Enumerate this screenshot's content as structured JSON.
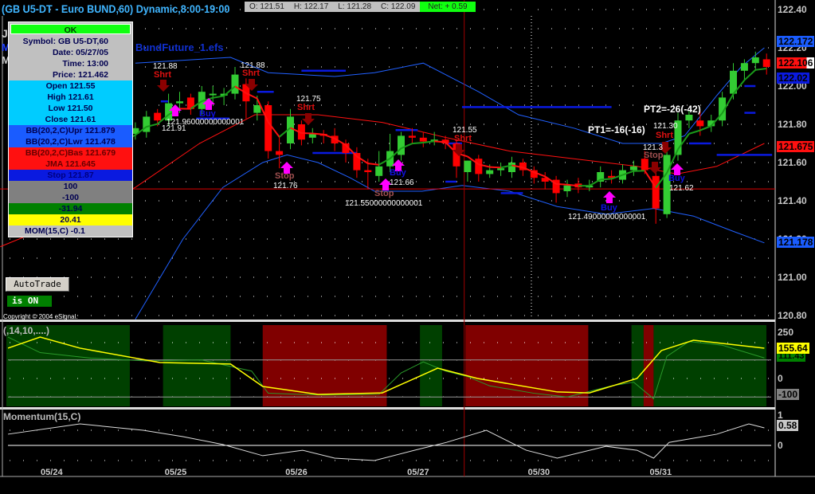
{
  "header": {
    "title": "(GB U5-DT - Euro BUND,60) Dynamic,8:00-19:00",
    "open": "O: 121.51",
    "high": "H: 122.17",
    "low": "L: 121.28",
    "close": "C: 122.09",
    "net": "Net: + 0.59"
  },
  "left_letters": [
    "J",
    "M",
    "M"
  ],
  "study_label": "BundFuture_1.efs",
  "popup": {
    "ok": "OK",
    "symbol": "Symbol: GB U5-DT,60",
    "date": "Date: 05/27/05",
    "time": "Time: 13:00",
    "price": "Price: 121.462",
    "open": "Open 121.55",
    "high": "High 121.61",
    "low": "Low 121.50",
    "close": "Close 121.61",
    "bbu": "BB(20,2,C)Upr 121.879",
    "bbl": "BB(20,2,C)Lwr 121.478",
    "bbb": "BB(20,2,C)Bas 121.679",
    "jma": "JMA 121.645",
    "stop": "Stop 121.87",
    "v100": "100",
    "vm100": "-100",
    "osc1": "-31.94",
    "osc2": "20.41",
    "mom": "MOM(15,C) -0.1"
  },
  "autotrade": {
    "button": "AutoTrade",
    "status": "is ON"
  },
  "copyright": "Copyright © 2004 eSignal.",
  "annotations": {
    "s1p": "121.88",
    "s1": "Shrt",
    "s2p": "121.88",
    "s2": "Shrt",
    "s3p": "121.75",
    "s3": "Shrt",
    "s4p": "121.55",
    "s4": "Shrt",
    "s5p": "121.30",
    "s5": "Shrt",
    "st3p": "121.3",
    "st3": "Stop",
    "b1p": "121.96000000000001",
    "b1p2": "121.91",
    "b2": "Buy",
    "b3": "Buy",
    "b3p": "121.66",
    "b4": "Buy",
    "b4p": "121.49000000000001",
    "b5": "Buy",
    "b5p": "121.62",
    "st1": "Stop",
    "st1p": "121.76",
    "st2": "Stop",
    "st2p": "121.55000000000001",
    "pt1": "PT1=-16(-16)",
    "pt2": "PT2=-26(-42)"
  },
  "price_scale": {
    "ticks": [
      "122.40",
      "122.20",
      "122.00",
      "121.80",
      "121.60",
      "121.40",
      "121.20",
      "121.00",
      "120.80"
    ],
    "tags": [
      {
        "v": "122.172",
        "color": "#1a5cff"
      },
      {
        "v": "122.106",
        "color": "#ff1010"
      },
      {
        "v": "122.02",
        "color": "#0a1ae0"
      },
      {
        "v": "121.675",
        "color": "#ff1010"
      },
      {
        "v": "121.178",
        "color": "#1a5cff"
      }
    ]
  },
  "osc_panel": {
    "label": "(,14,10,....)",
    "ticks": [
      "250",
      "0"
    ],
    "tags": [
      {
        "v": "155.64",
        "color": "#ffff00"
      },
      {
        "v": "111.43",
        "color": "#008000"
      },
      {
        "v": "-100",
        "color": "#808080"
      }
    ]
  },
  "mom_panel": {
    "label": "Momentum(15,C)",
    "ticks": [
      "1",
      "0"
    ],
    "tag": "0.58"
  },
  "chart_data": {
    "type": "candlestick",
    "title": "GB U5-DT - Euro BUND,60",
    "x_tick_labels": [
      "05/24",
      "05/25",
      "05/26",
      "05/27",
      "05/30",
      "05/31"
    ],
    "x_tick_bars": [
      3.6,
      14.8,
      25.7,
      36.7,
      47.6,
      58.6
    ],
    "ylim": [
      120.8,
      122.4
    ],
    "colors": {
      "up": "#33cc33",
      "down": "#ff0000",
      "band": "#2060ff",
      "basis": "#ff1010",
      "stop": "#0a1ae0"
    },
    "candles": [
      [
        121.5,
        121.58,
        121.47,
        121.55
      ],
      [
        121.55,
        121.58,
        121.47,
        121.5
      ],
      [
        121.5,
        121.55,
        121.47,
        121.52
      ],
      [
        121.52,
        121.58,
        121.49,
        121.55
      ],
      [
        121.55,
        121.61,
        121.52,
        121.58
      ],
      [
        121.58,
        121.63,
        121.55,
        121.6
      ],
      [
        121.6,
        121.65,
        121.57,
        121.62
      ],
      [
        121.62,
        121.68,
        121.59,
        121.65
      ],
      [
        121.65,
        121.73,
        121.62,
        121.7
      ],
      [
        121.7,
        121.75,
        121.67,
        121.72
      ],
      [
        121.72,
        121.78,
        121.69,
        121.75
      ],
      [
        121.75,
        121.81,
        121.72,
        121.78
      ],
      [
        121.76,
        121.87,
        121.73,
        121.84
      ],
      [
        121.86,
        121.88,
        121.79,
        121.82
      ],
      [
        121.82,
        121.96,
        121.79,
        121.91
      ],
      [
        121.91,
        121.97,
        121.86,
        121.92
      ],
      [
        121.94,
        121.96,
        121.85,
        121.88
      ],
      [
        121.88,
        122.0,
        121.85,
        121.97
      ],
      [
        121.96,
        122.0,
        121.91,
        121.96
      ],
      [
        121.95,
        121.99,
        121.9,
        121.96
      ],
      [
        121.96,
        122.1,
        121.93,
        122.06
      ],
      [
        122.01,
        122.04,
        121.83,
        121.92
      ],
      [
        121.86,
        121.95,
        121.82,
        121.9
      ],
      [
        121.9,
        121.92,
        121.62,
        121.66
      ],
      [
        121.66,
        121.74,
        121.57,
        121.64
      ],
      [
        121.7,
        121.88,
        121.67,
        121.84
      ],
      [
        121.8,
        121.82,
        121.69,
        121.72
      ],
      [
        121.73,
        121.78,
        121.7,
        121.75
      ],
      [
        121.75,
        121.77,
        121.7,
        121.74
      ],
      [
        121.74,
        121.78,
        121.66,
        121.7
      ],
      [
        121.7,
        121.72,
        121.6,
        121.65
      ],
      [
        121.65,
        121.68,
        121.52,
        121.56
      ],
      [
        121.56,
        121.62,
        121.46,
        121.55
      ],
      [
        121.53,
        121.66,
        121.5,
        121.58
      ],
      [
        121.58,
        121.75,
        121.55,
        121.66
      ],
      [
        121.64,
        121.76,
        121.61,
        121.74
      ],
      [
        121.74,
        121.78,
        121.7,
        121.73
      ],
      [
        121.73,
        121.76,
        121.68,
        121.71
      ],
      [
        121.71,
        121.76,
        121.69,
        121.72
      ],
      [
        121.72,
        121.74,
        121.67,
        121.7
      ],
      [
        121.7,
        121.72,
        121.52,
        121.58
      ],
      [
        121.55,
        121.61,
        121.5,
        121.61
      ],
      [
        121.62,
        121.64,
        121.5,
        121.54
      ],
      [
        121.54,
        121.59,
        121.52,
        121.56
      ],
      [
        121.56,
        121.6,
        121.53,
        121.57
      ],
      [
        121.55,
        121.63,
        121.52,
        121.6
      ],
      [
        121.6,
        121.62,
        121.53,
        121.56
      ],
      [
        121.56,
        121.58,
        121.49,
        121.52
      ],
      [
        121.52,
        121.55,
        121.46,
        121.5
      ],
      [
        121.51,
        121.53,
        121.39,
        121.44
      ],
      [
        121.45,
        121.51,
        121.42,
        121.48
      ],
      [
        121.49,
        121.52,
        121.44,
        121.47
      ],
      [
        121.47,
        121.51,
        121.45,
        121.48
      ],
      [
        121.5,
        121.58,
        121.47,
        121.55
      ],
      [
        121.53,
        121.56,
        121.49,
        121.52
      ],
      [
        121.51,
        121.59,
        121.49,
        121.56
      ],
      [
        121.56,
        121.61,
        121.53,
        121.58
      ],
      [
        121.62,
        121.66,
        121.54,
        121.56
      ],
      [
        121.53,
        121.56,
        121.28,
        121.36
      ],
      [
        121.33,
        121.7,
        121.31,
        121.64
      ],
      [
        121.64,
        121.86,
        121.61,
        121.82
      ],
      [
        121.82,
        121.87,
        121.78,
        121.85
      ],
      [
        121.82,
        121.87,
        121.74,
        121.79
      ],
      [
        121.79,
        121.85,
        121.76,
        121.82
      ],
      [
        121.82,
        121.97,
        121.79,
        121.94
      ],
      [
        121.96,
        122.12,
        121.93,
        122.08
      ],
      [
        122.08,
        122.14,
        122.03,
        122.12
      ],
      [
        122.12,
        122.18,
        122.08,
        122.15
      ],
      [
        122.14,
        122.17,
        122.06,
        122.1
      ]
    ],
    "bb_upper": [
      [
        11,
        122.12
      ],
      [
        19.6,
        122.15
      ],
      [
        23,
        122.07
      ],
      [
        29,
        122.05
      ],
      [
        32.6,
        122.07
      ],
      [
        37,
        122.12
      ],
      [
        42,
        121.97
      ],
      [
        45.6,
        121.85
      ],
      [
        50.6,
        121.78
      ],
      [
        55,
        121.7
      ],
      [
        58.5,
        121.7
      ],
      [
        60.6,
        121.74
      ],
      [
        63.5,
        121.95
      ],
      [
        65.7,
        122.1
      ],
      [
        67.8,
        122.2
      ]
    ],
    "bb_lower": [
      [
        11,
        120.78
      ],
      [
        15.3,
        121.2
      ],
      [
        18.9,
        121.47
      ],
      [
        22.5,
        121.6
      ],
      [
        24.7,
        121.64
      ],
      [
        27.5,
        121.6
      ],
      [
        30.4,
        121.52
      ],
      [
        32.6,
        121.45
      ],
      [
        36.9,
        121.45
      ],
      [
        40.5,
        121.48
      ],
      [
        44.8,
        121.45
      ],
      [
        49.1,
        121.37
      ],
      [
        53.5,
        121.33
      ],
      [
        57.8,
        121.36
      ],
      [
        61.4,
        121.32
      ],
      [
        65,
        121.24
      ],
      [
        67.8,
        121.18
      ]
    ],
    "bb_basis": [
      [
        -1.2,
        121.16
      ],
      [
        6,
        121.33
      ],
      [
        11,
        121.47
      ],
      [
        16.8,
        121.7
      ],
      [
        21.8,
        121.85
      ],
      [
        27.5,
        121.85
      ],
      [
        33.3,
        121.81
      ],
      [
        39.1,
        121.73
      ],
      [
        44.8,
        121.66
      ],
      [
        50.6,
        121.62
      ],
      [
        56.3,
        121.58
      ],
      [
        59.9,
        121.54
      ],
      [
        63.5,
        121.58
      ],
      [
        67.8,
        121.7
      ]
    ],
    "stops": [
      [
        13.3,
        14,
        121.92
      ],
      [
        16.5,
        19.5,
        121.83
      ],
      [
        22,
        23.5,
        121.97
      ],
      [
        26,
        30,
        122.08
      ],
      [
        27,
        31,
        121.65
      ],
      [
        34.5,
        36.5,
        121.77
      ],
      [
        39,
        40.5,
        121.7
      ],
      [
        40.5,
        54,
        121.89
      ],
      [
        39,
        40,
        121.5
      ],
      [
        44,
        46,
        121.44
      ],
      [
        61,
        63,
        121.7
      ],
      [
        63.5,
        68.5,
        121.64
      ],
      [
        66,
        67,
        121.86
      ],
      [
        66,
        67,
        122.0
      ]
    ],
    "cursor_bar": 40.7,
    "cursor_price": 121.462,
    "osc": {
      "range": [
        -150,
        250
      ],
      "levels": [
        100,
        -100
      ],
      "zones": [
        [
          -0.7,
          10.5,
          "g"
        ],
        [
          13.5,
          19.6,
          "g"
        ],
        [
          22.5,
          33.7,
          "r"
        ],
        [
          36.7,
          38.7,
          "g"
        ],
        [
          40.8,
          51.9,
          "r"
        ],
        [
          55.8,
          56.9,
          "g"
        ],
        [
          56.9,
          57.8,
          "r"
        ],
        [
          57.8,
          68,
          "g"
        ]
      ],
      "signal": [
        [
          -0.5,
          164
        ],
        [
          2.4,
          224
        ],
        [
          6,
          164
        ],
        [
          13.2,
          86
        ],
        [
          19.6,
          78
        ],
        [
          22.5,
          -43
        ],
        [
          27.5,
          -86
        ],
        [
          33.3,
          -78
        ],
        [
          38.3,
          56
        ],
        [
          41.9,
          0
        ],
        [
          49.1,
          -73
        ],
        [
          52,
          -78
        ],
        [
          56.3,
          0
        ],
        [
          58.5,
          151
        ],
        [
          61.4,
          207
        ],
        [
          67.8,
          164
        ]
      ],
      "raw": [
        [
          -0.5,
          224
        ],
        [
          2.4,
          140
        ],
        [
          7,
          110
        ],
        [
          12,
          95
        ],
        [
          17,
          100
        ],
        [
          21.5,
          40
        ],
        [
          23,
          -80
        ],
        [
          28,
          -90
        ],
        [
          33,
          -86
        ],
        [
          35,
          30
        ],
        [
          37,
          90
        ],
        [
          39,
          40
        ],
        [
          41,
          10
        ],
        [
          43,
          -40
        ],
        [
          47,
          -80
        ],
        [
          50,
          -100
        ],
        [
          54,
          -40
        ],
        [
          56,
          -20
        ],
        [
          57.8,
          -110
        ],
        [
          59,
          120
        ],
        [
          61,
          200
        ],
        [
          64,
          180
        ],
        [
          67.8,
          111
        ]
      ]
    },
    "momentum": {
      "range": [
        -0.8,
        1.2
      ],
      "values": [
        [
          -0.5,
          0.37
        ],
        [
          6,
          0.71
        ],
        [
          11.7,
          0.5
        ],
        [
          15.3,
          0.29
        ],
        [
          18.9,
          0.03
        ],
        [
          22.5,
          -0.34
        ],
        [
          26.1,
          -0.16
        ],
        [
          29,
          -0.42
        ],
        [
          32.6,
          -0.5
        ],
        [
          36.2,
          -0.16
        ],
        [
          39.1,
          0.1
        ],
        [
          42.7,
          0.5
        ],
        [
          46.3,
          -0.16
        ],
        [
          49.1,
          -0.42
        ],
        [
          53.5,
          -0.03
        ],
        [
          56.3,
          -0.16
        ],
        [
          57.8,
          -0.42
        ],
        [
          59.2,
          0.1
        ],
        [
          63.5,
          0.37
        ],
        [
          66.4,
          0.71
        ],
        [
          67.8,
          0.58
        ]
      ]
    }
  }
}
